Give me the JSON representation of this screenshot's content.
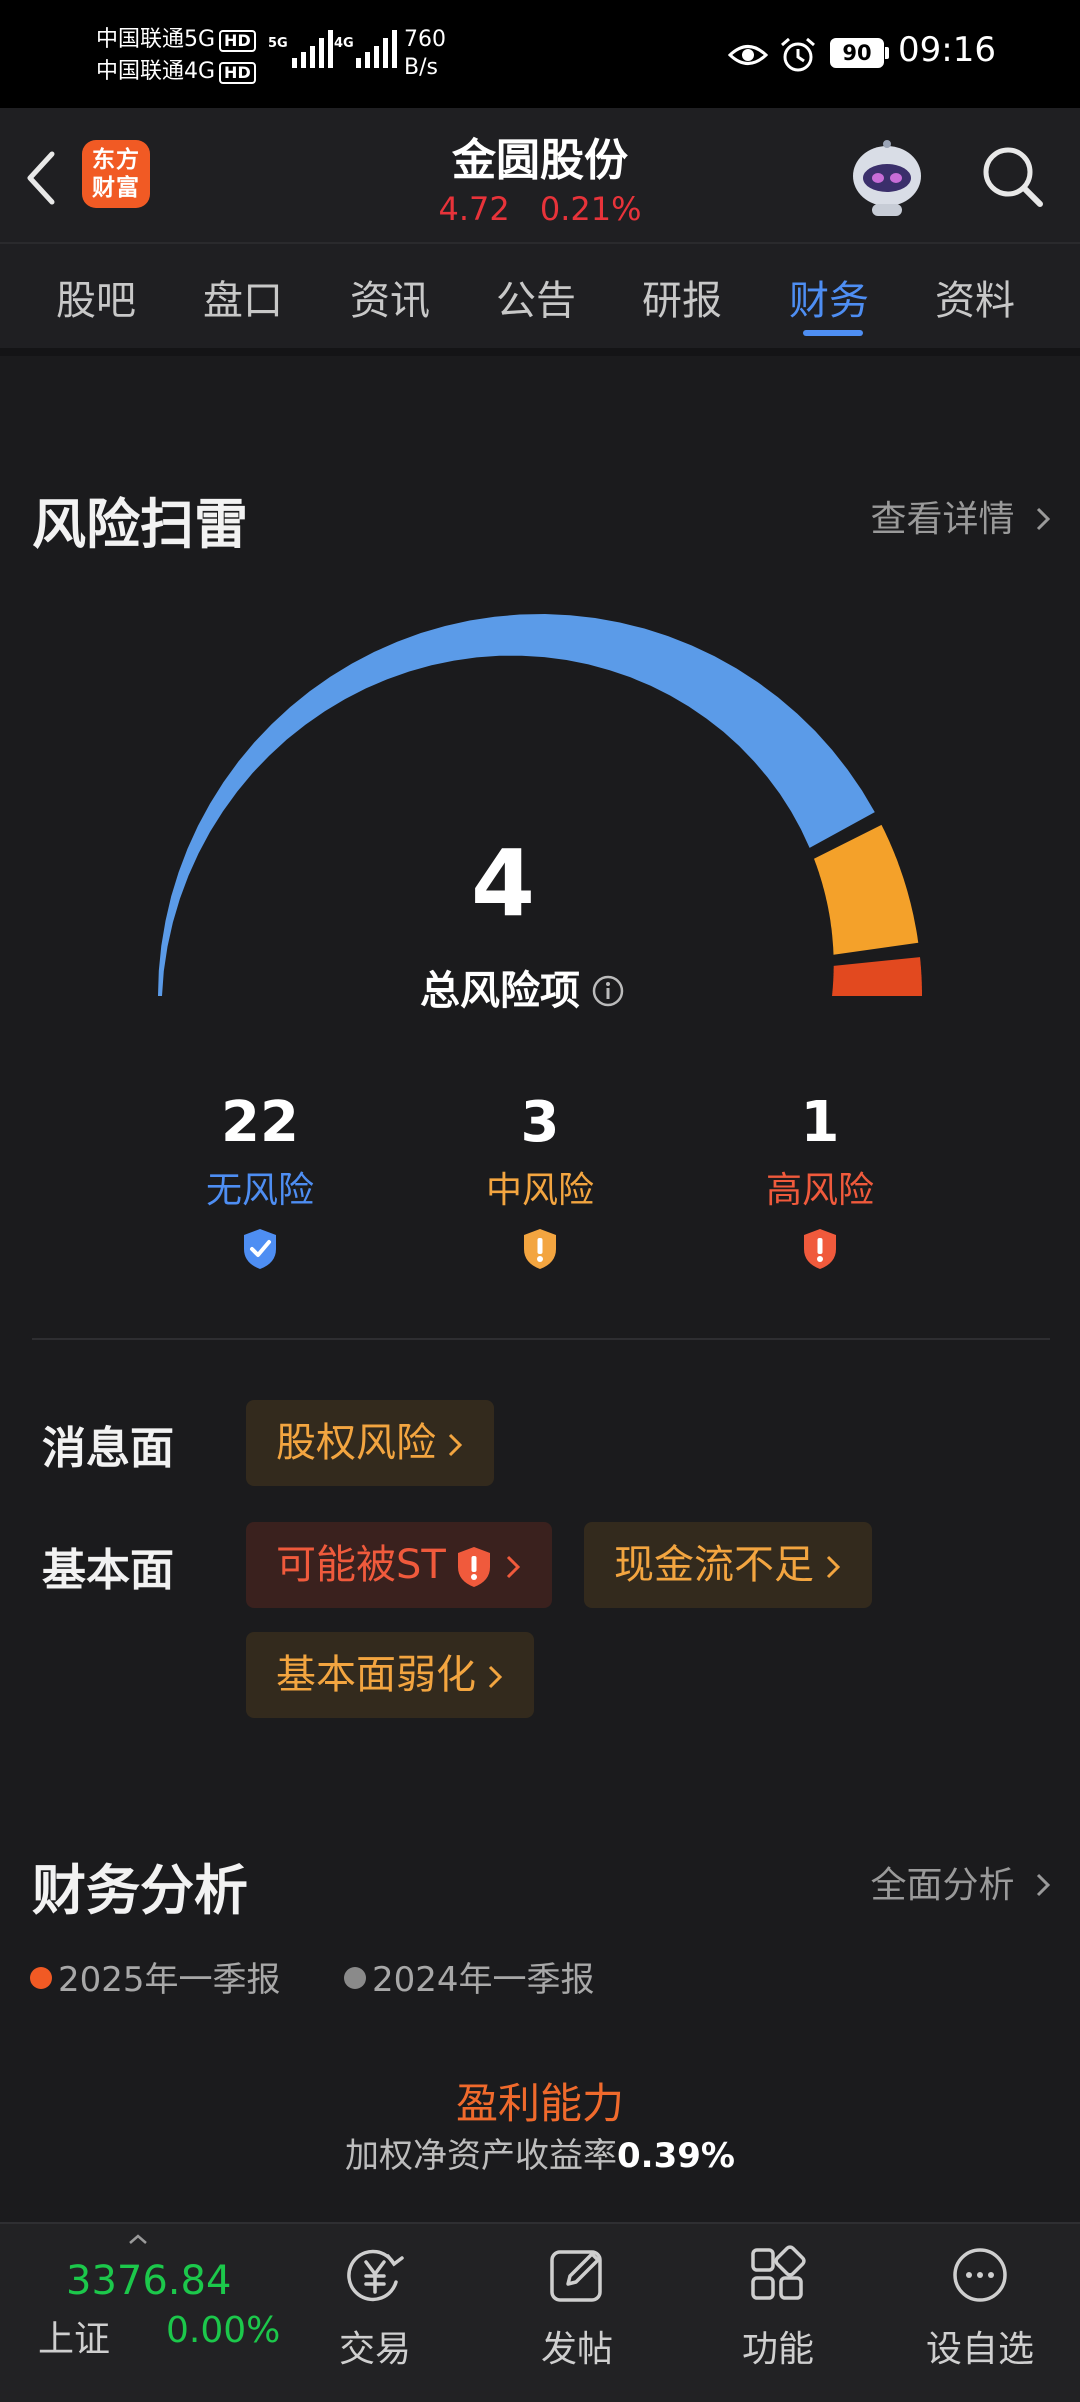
{
  "status_bar": {
    "carrier_1": "中国联通5G",
    "carrier_2": "中国联通4G",
    "hd_badge": "HD",
    "sig_5g": "5G",
    "sig_4g": "4G",
    "net_speed_value": "760",
    "net_speed_unit": "B/s",
    "battery": "90",
    "time": "09:16"
  },
  "header": {
    "logo_line1": "东方",
    "logo_line2": "财富",
    "stock_name": "金圆股份",
    "price": "4.72",
    "change_pct": "0.21%"
  },
  "tabs": [
    {
      "label": "股吧"
    },
    {
      "label": "盘口"
    },
    {
      "label": "资讯"
    },
    {
      "label": "公告"
    },
    {
      "label": "研报"
    },
    {
      "label": "财务",
      "active": true
    },
    {
      "label": "资料"
    }
  ],
  "risk": {
    "title": "风险扫雷",
    "detail_link": "查看详情",
    "total_count": "4",
    "total_label": "总风险项",
    "gauge_segments": [
      {
        "name": "无风险",
        "value": 22,
        "color": "#5b9be8"
      },
      {
        "name": "中风险",
        "value": 3,
        "color": "#f4a12a"
      },
      {
        "name": "高风险",
        "value": 1,
        "color": "#e2491f"
      }
    ],
    "stats": [
      {
        "count": "22",
        "label": "无风险",
        "color": "#4e8ef3"
      },
      {
        "count": "3",
        "label": "中风险",
        "color": "#f3a540"
      },
      {
        "count": "1",
        "label": "高风险",
        "color": "#f05a3c"
      }
    ],
    "news_label": "消息面",
    "news_tags": [
      "股权风险"
    ],
    "fundamental_label": "基本面",
    "fundamental_tags": [
      "可能被ST",
      "现金流不足",
      "基本面弱化"
    ]
  },
  "finance": {
    "title": "财务分析",
    "full_link": "全面分析",
    "legend": [
      "2025年一季报",
      "2024年一季报"
    ],
    "legend_colors": [
      "#f15a24",
      "#8a8a8a"
    ],
    "profit_title": "盈利能力",
    "profit_metric_label": "加权净资产收益率",
    "profit_metric_value": "0.39%"
  },
  "bottom_bar": {
    "index_value": "3376.84",
    "index_name": "上证",
    "index_change": "0.00%",
    "nav": [
      {
        "label": "交易",
        "icon": "trade-yuan-icon"
      },
      {
        "label": "发帖",
        "icon": "compose-icon"
      },
      {
        "label": "功能",
        "icon": "grid-apps-icon"
      },
      {
        "label": "设自选",
        "icon": "more-dots-icon"
      }
    ]
  }
}
